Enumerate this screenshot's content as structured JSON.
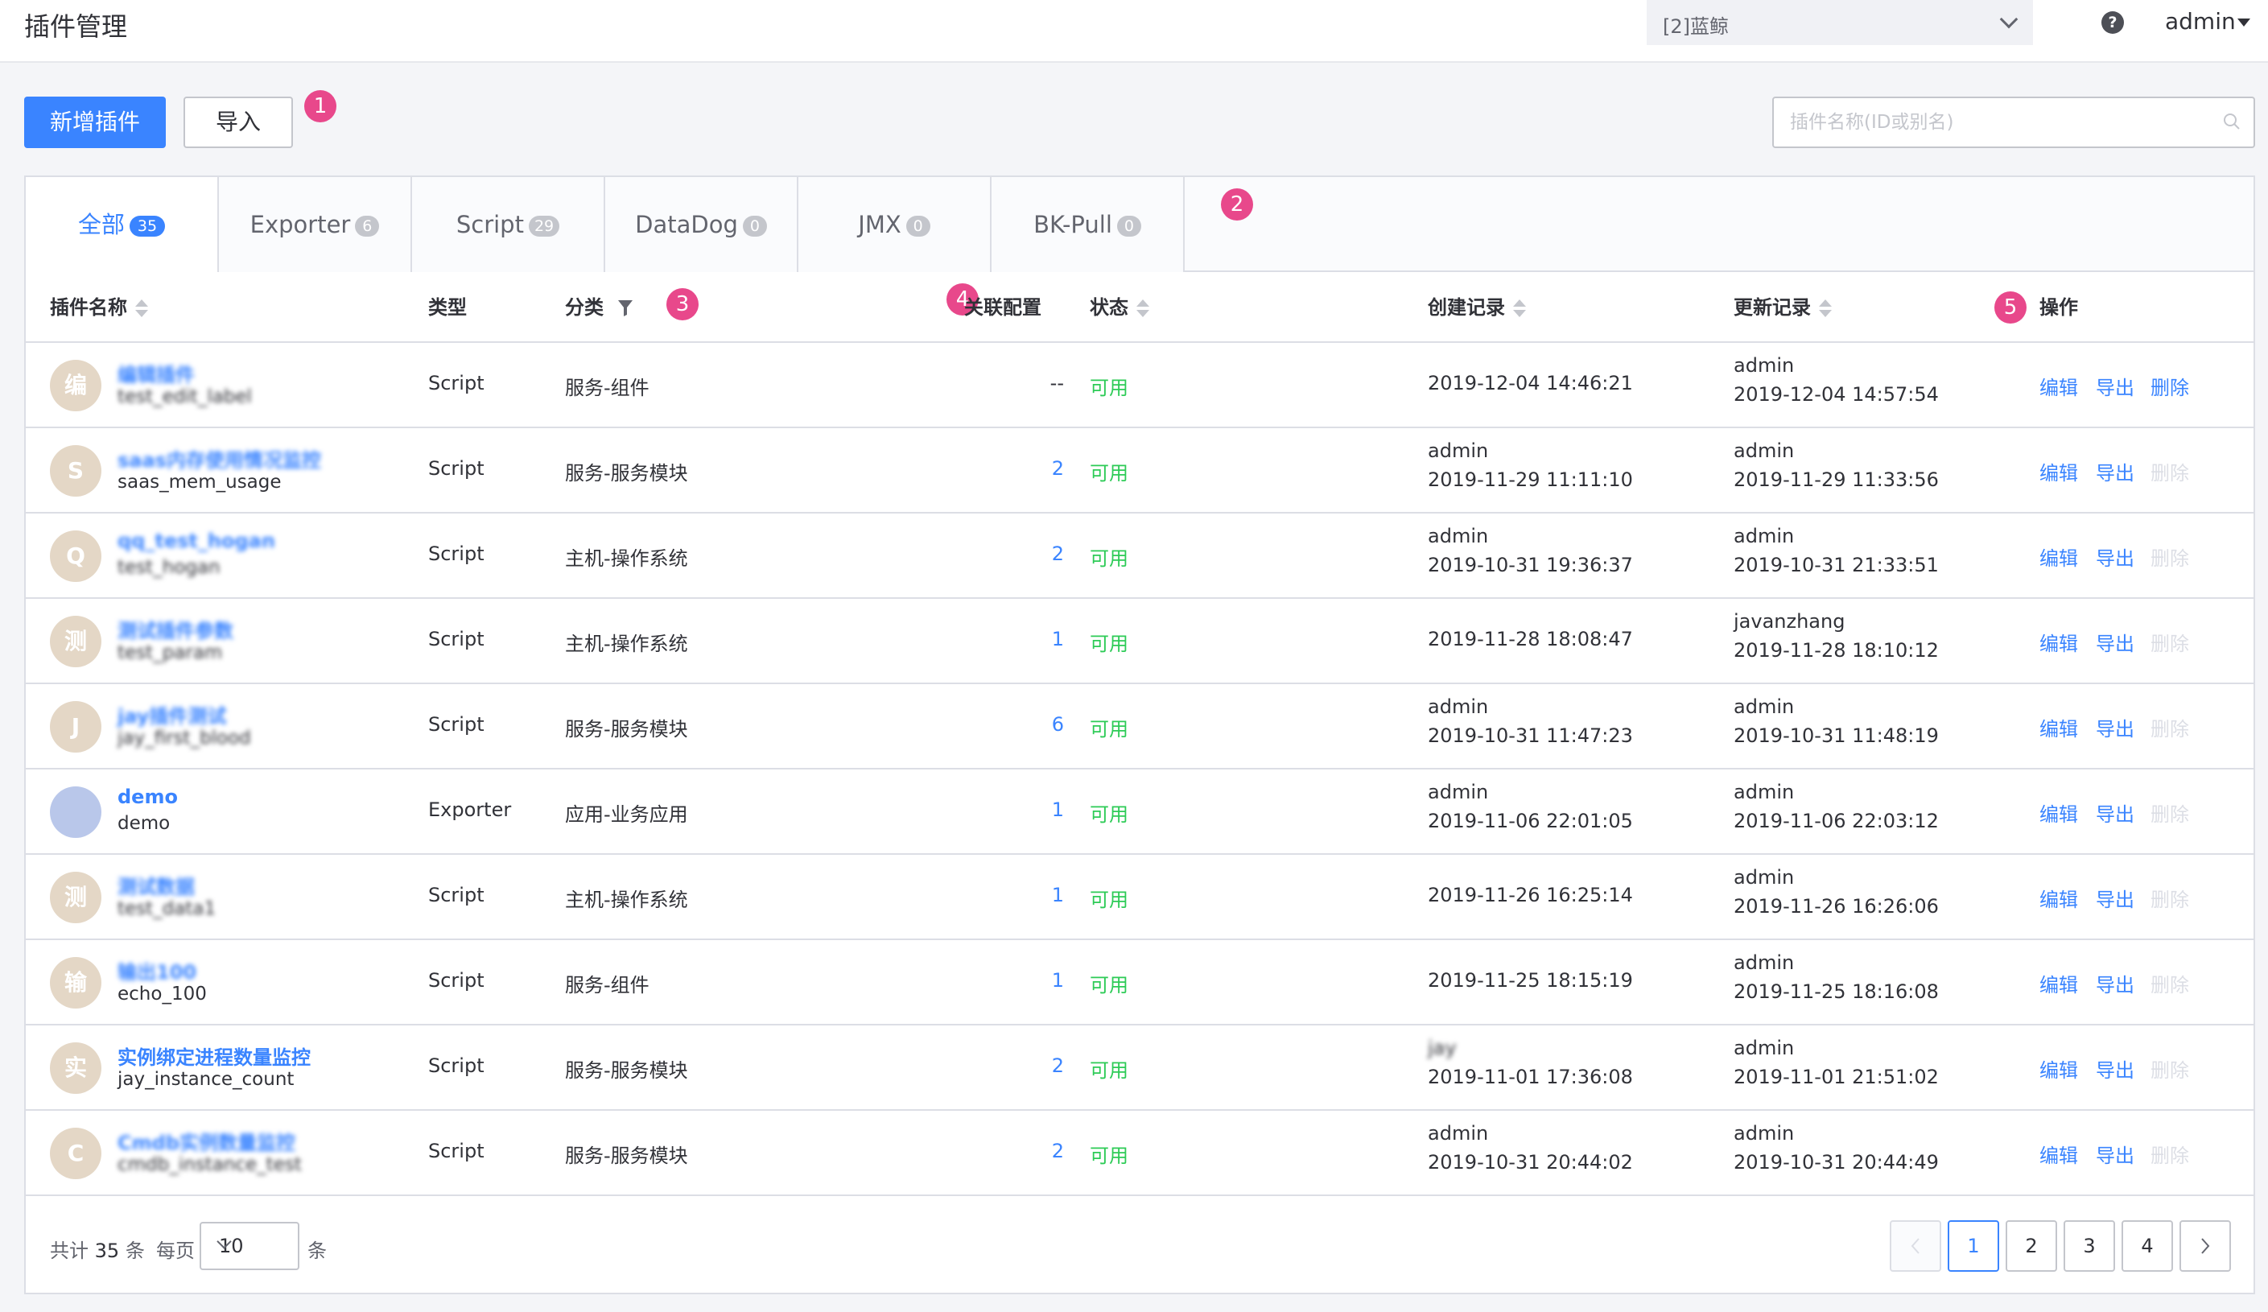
{
  "header": {
    "title": "插件管理",
    "business": "[2]蓝鲸",
    "help_icon": "question-circle-icon",
    "user": "admin"
  },
  "toolbar": {
    "add_label": "新增插件",
    "import_label": "导入",
    "search_placeholder": "插件名称(ID或别名)"
  },
  "markers": [
    "1",
    "2",
    "3",
    "4",
    "5"
  ],
  "tabs": [
    {
      "label": "全部",
      "count": "35",
      "active": true
    },
    {
      "label": "Exporter",
      "count": "6"
    },
    {
      "label": "Script",
      "count": "29"
    },
    {
      "label": "DataDog",
      "count": "0"
    },
    {
      "label": "JMX",
      "count": "0"
    },
    {
      "label": "BK-Pull",
      "count": "0"
    }
  ],
  "columns": {
    "name": "插件名称",
    "type": "类型",
    "category": "分类",
    "related": "关联配置",
    "status": "状态",
    "created": "创建记录",
    "updated": "更新记录",
    "actions": "操作"
  },
  "rows": [
    {
      "avatar": "编",
      "name": "编辑插件",
      "id": "test_edit_label",
      "type": "Script",
      "category": "服务-组件",
      "related": "--",
      "status": "可用",
      "created_by": "",
      "created_at": "2019-12-04 14:46:21",
      "updated_by": "admin",
      "updated_at": "2019-12-04 14:57:54",
      "edit": "编辑",
      "export": "导出",
      "delete": "删除",
      "delete_enabled": true
    },
    {
      "avatar": "S",
      "name": "saas内存使用情况监控",
      "id": "saas_mem_usage",
      "type": "Script",
      "category": "服务-服务模块",
      "related": "2",
      "status": "可用",
      "created_by": "admin",
      "created_at": "2019-11-29 11:11:10",
      "updated_by": "admin",
      "updated_at": "2019-11-29 11:33:56",
      "edit": "编辑",
      "export": "导出",
      "delete": "删除",
      "delete_enabled": false
    },
    {
      "avatar": "Q",
      "name": "qq_test_hogan",
      "id": "test_hogan",
      "type": "Script",
      "category": "主机-操作系统",
      "related": "2",
      "status": "可用",
      "created_by": "admin",
      "created_at": "2019-10-31 19:36:37",
      "updated_by": "admin",
      "updated_at": "2019-10-31 21:33:51",
      "edit": "编辑",
      "export": "导出",
      "delete": "删除",
      "delete_enabled": false
    },
    {
      "avatar": "测",
      "name": "测试插件参数",
      "id": "test_param",
      "type": "Script",
      "category": "主机-操作系统",
      "related": "1",
      "status": "可用",
      "created_by": "",
      "created_at": "2019-11-28 18:08:47",
      "updated_by": "javanzhang",
      "updated_at": "2019-11-28 18:10:12",
      "edit": "编辑",
      "export": "导出",
      "delete": "删除",
      "delete_enabled": false
    },
    {
      "avatar": "J",
      "name": "jay插件测试",
      "id": "jay_first_blood",
      "type": "Script",
      "category": "服务-服务模块",
      "related": "6",
      "status": "可用",
      "created_by": "admin",
      "created_at": "2019-10-31 11:47:23",
      "updated_by": "admin",
      "updated_at": "2019-10-31 11:48:19",
      "edit": "编辑",
      "export": "导出",
      "delete": "删除",
      "delete_enabled": false
    },
    {
      "avatar": "",
      "name": "demo",
      "id": "demo",
      "type": "Exporter",
      "category": "应用-业务应用",
      "related": "1",
      "status": "可用",
      "created_by": "admin",
      "created_at": "2019-11-06 22:01:05",
      "updated_by": "admin",
      "updated_at": "2019-11-06 22:03:12",
      "edit": "编辑",
      "export": "导出",
      "delete": "删除",
      "delete_enabled": false
    },
    {
      "avatar": "测",
      "name": "测试数据",
      "id": "test_data1",
      "type": "Script",
      "category": "主机-操作系统",
      "related": "1",
      "status": "可用",
      "created_by": "",
      "created_at": "2019-11-26 16:25:14",
      "updated_by": "admin",
      "updated_at": "2019-11-26 16:26:06",
      "edit": "编辑",
      "export": "导出",
      "delete": "删除",
      "delete_enabled": false
    },
    {
      "avatar": "输",
      "name": "输出100",
      "id": "echo_100",
      "type": "Script",
      "category": "服务-组件",
      "related": "1",
      "status": "可用",
      "created_by": "",
      "created_at": "2019-11-25 18:15:19",
      "updated_by": "admin",
      "updated_at": "2019-11-25 18:16:08",
      "edit": "编辑",
      "export": "导出",
      "delete": "删除",
      "delete_enabled": false
    },
    {
      "avatar": "实",
      "name": "实例绑定进程数量监控",
      "id": "jay_instance_count",
      "type": "Script",
      "category": "服务-服务模块",
      "related": "2",
      "status": "可用",
      "created_by": "jay",
      "created_at": "2019-11-01 17:36:08",
      "updated_by": "admin",
      "updated_at": "2019-11-01 21:51:02",
      "edit": "编辑",
      "export": "导出",
      "delete": "删除",
      "delete_enabled": false
    },
    {
      "avatar": "C",
      "name": "Cmdb实例数量监控",
      "id": "cmdb_instance_test",
      "type": "Script",
      "category": "服务-服务模块",
      "related": "2",
      "status": "可用",
      "created_by": "admin",
      "created_at": "2019-10-31 20:44:02",
      "updated_by": "admin",
      "updated_at": "2019-10-31 20:44:49",
      "edit": "编辑",
      "export": "导出",
      "delete": "删除",
      "delete_enabled": false
    }
  ],
  "pagination": {
    "total_prefix": "共计",
    "total": "35",
    "total_suffix": "条",
    "per_page_label": "每页",
    "per_page": "10",
    "per_page_unit": "条",
    "pages": [
      "1",
      "2",
      "3",
      "4"
    ],
    "current": "1"
  }
}
